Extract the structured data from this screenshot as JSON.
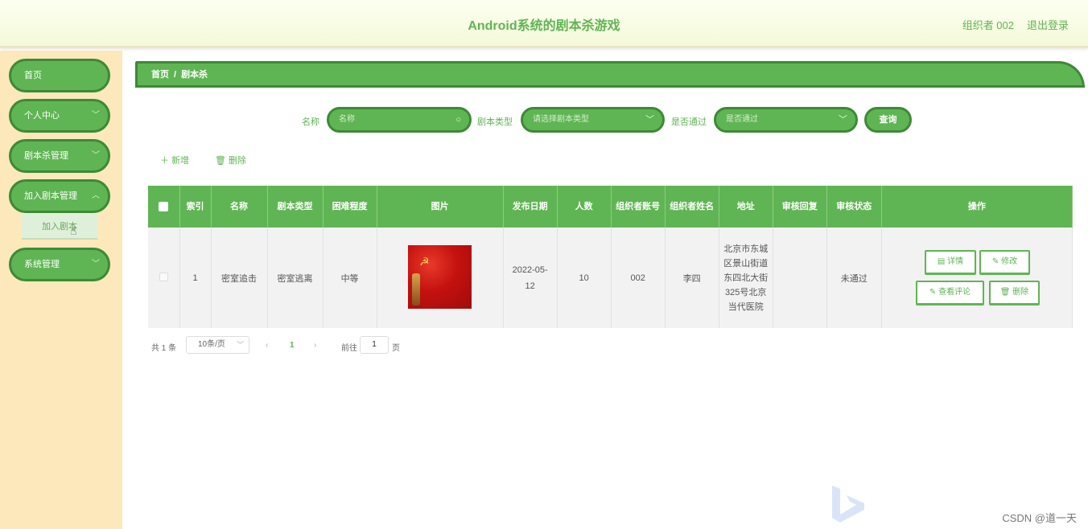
{
  "header": {
    "title": "Android系统的剧本杀游戏",
    "user": "组织者 002",
    "logout": "退出登录"
  },
  "sidebar": {
    "items": [
      {
        "label": "首页"
      },
      {
        "label": "个人中心"
      },
      {
        "label": "剧本杀管理"
      },
      {
        "label": "加入剧本管理"
      },
      {
        "label": "系统管理"
      }
    ],
    "sub_item": "加入剧本"
  },
  "breadcrumb": {
    "home": "首页",
    "sep": "/",
    "current": "剧本杀"
  },
  "search": {
    "name_label": "名称",
    "name_placeholder": "名称",
    "type_label": "剧本类型",
    "type_placeholder": "请选择剧本类型",
    "pass_label": "是否通过",
    "pass_placeholder": "是否通过",
    "query": "查询"
  },
  "actions": {
    "add": "新增",
    "delete": "删除"
  },
  "table": {
    "headers": [
      "索引",
      "名称",
      "剧本类型",
      "困难程度",
      "图片",
      "发布日期",
      "人数",
      "组织者账号",
      "组织者姓名",
      "地址",
      "审核回复",
      "审核状态",
      "操作"
    ],
    "row": {
      "index": "1",
      "name": "密室追击",
      "type": "密室逃离",
      "difficulty": "中等",
      "date": "2022-05-12",
      "people": "10",
      "account": "002",
      "organizer": "李四",
      "address": "北京市东城区景山街道东四北大街325号北京当代医院",
      "reply": "",
      "status": "未通过"
    },
    "ops": {
      "detail": "详情",
      "edit": "修改",
      "comments": "查看评论",
      "delete": "删除"
    }
  },
  "pagination": {
    "total": "共 1 条",
    "size": "10条/页",
    "current": "1",
    "goto": "前往",
    "page_input": "1",
    "page_unit": "页"
  },
  "watermark": "CSDN @道一天",
  "colors": {
    "primary": "#5fb553",
    "primary_dark": "#3d8a35",
    "sidebar_bg": "#fce8bb"
  }
}
